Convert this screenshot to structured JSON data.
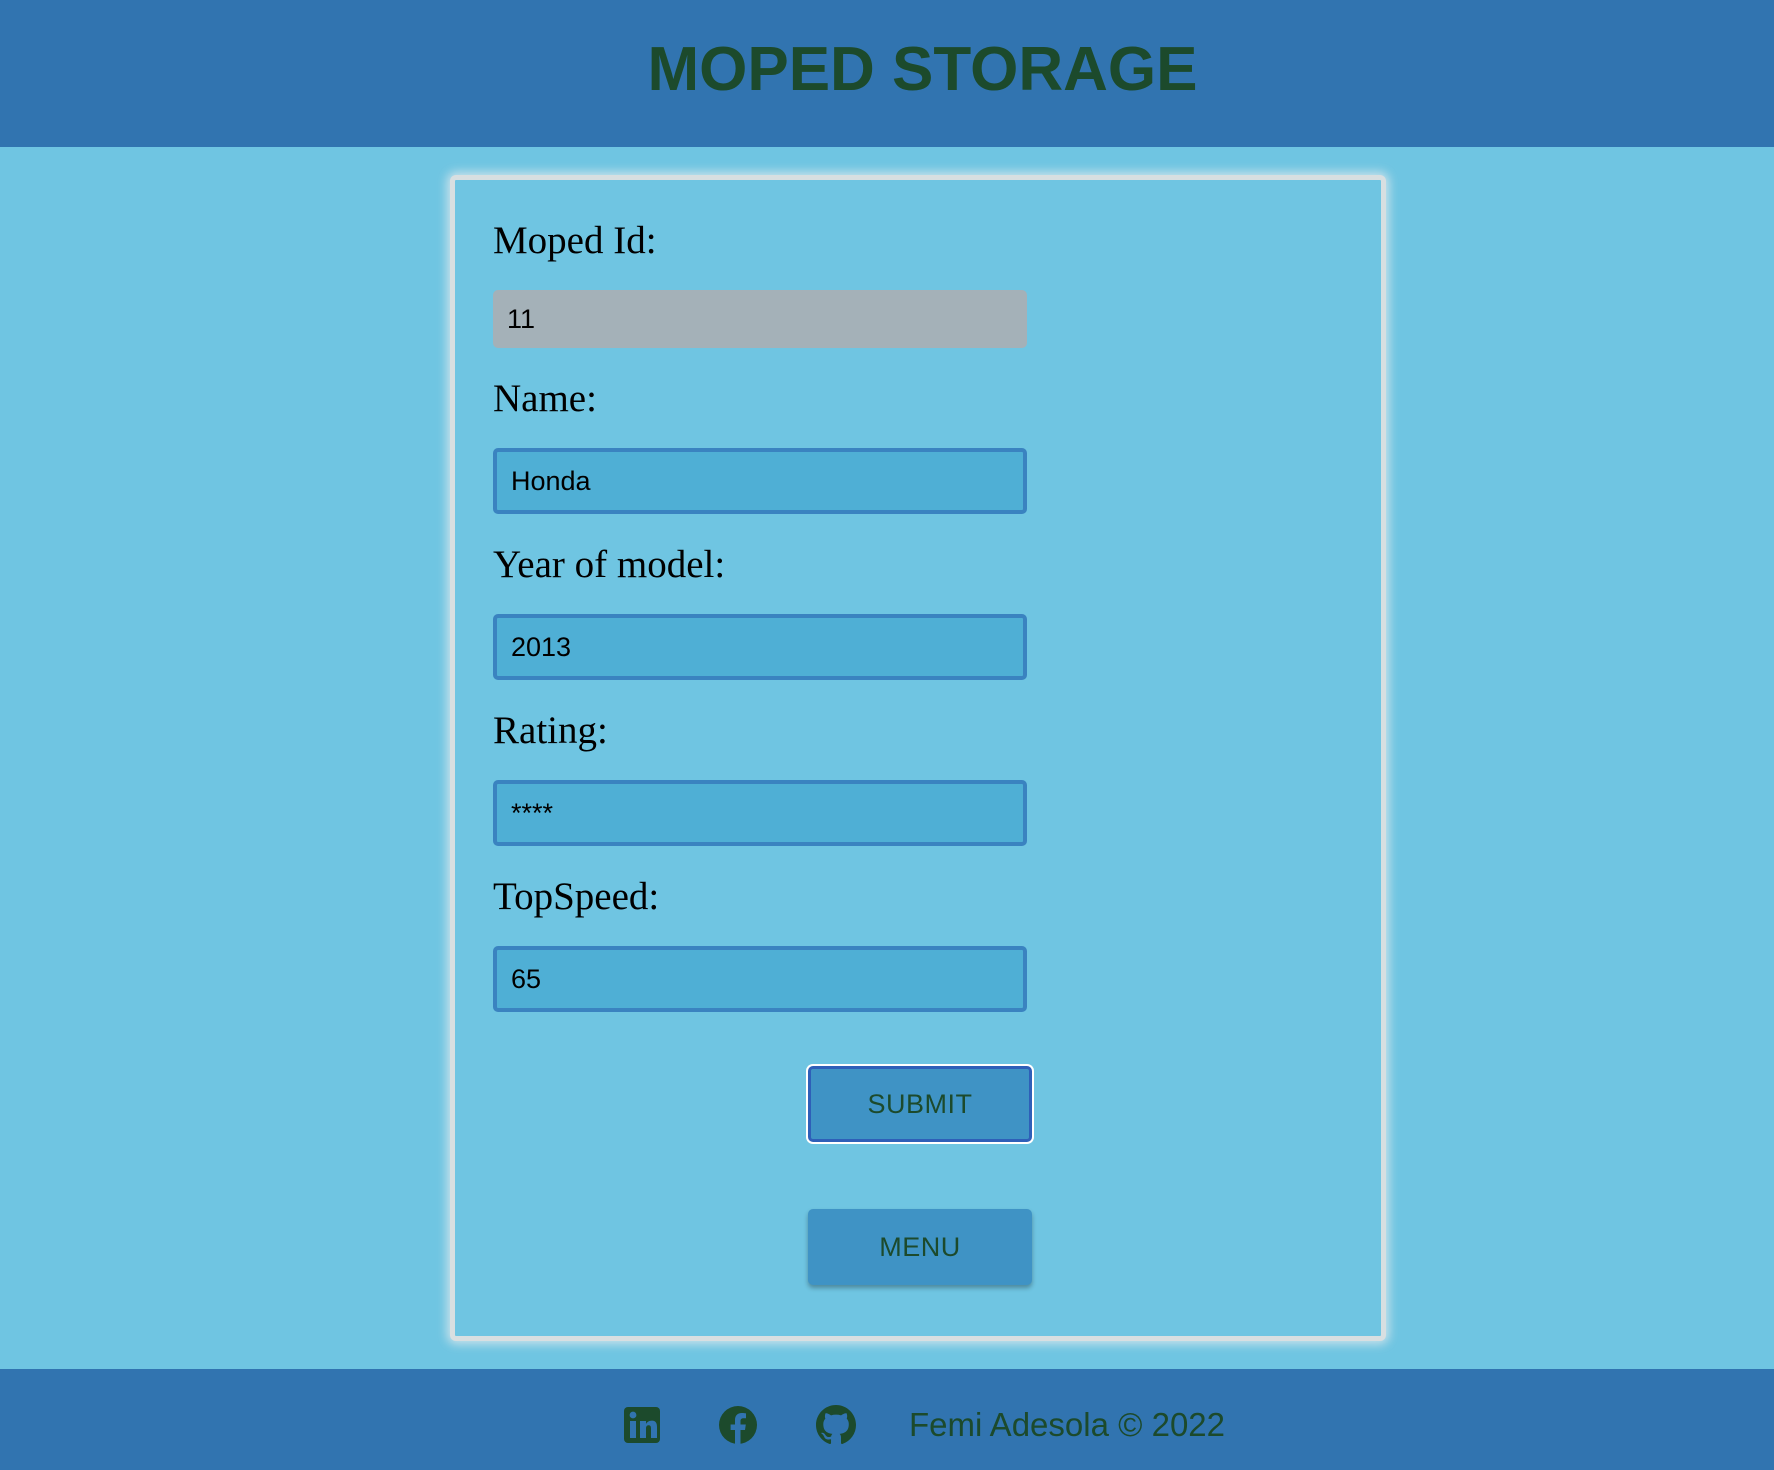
{
  "header": {
    "title": "MOPED STORAGE"
  },
  "form": {
    "moped_id": {
      "label": "Moped Id:",
      "value": "11"
    },
    "name": {
      "label": "Name:",
      "value": "Honda"
    },
    "year": {
      "label": "Year of model:",
      "value": "2013"
    },
    "rating": {
      "label": "Rating:",
      "value": "****"
    },
    "top_speed": {
      "label": "TopSpeed:",
      "value": "65"
    },
    "submit_label": "SUBMIT",
    "menu_label": "MENU"
  },
  "footer": {
    "icons": [
      "linkedin-icon",
      "facebook-icon",
      "github-icon"
    ],
    "credit": "Femi Adesola © 2022"
  },
  "colors": {
    "header_bg": "#3174b0",
    "page_bg": "#6fc5e2",
    "title_text": "#1c4a2c",
    "input_bg": "#4fafd5",
    "readonly_bg": "#a4b1b8",
    "button_bg": "#3f93c5"
  }
}
